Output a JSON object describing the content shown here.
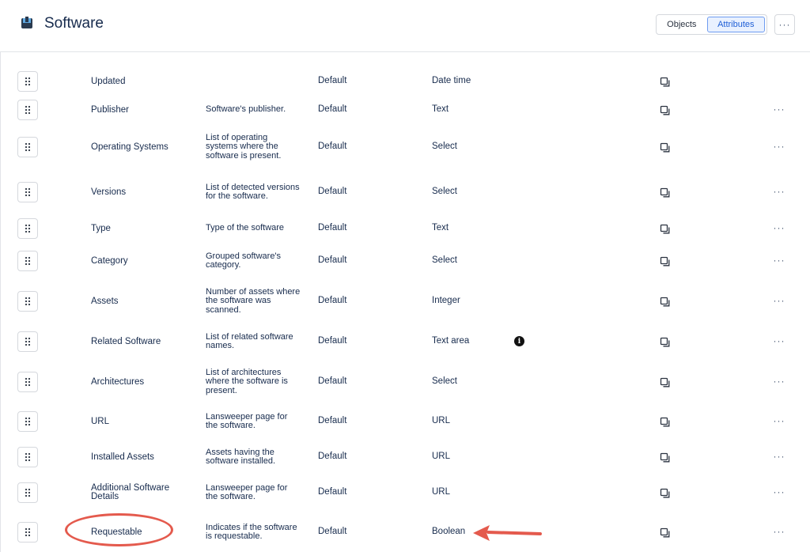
{
  "header": {
    "title": "Software",
    "toggle": {
      "objects_label": "Objects",
      "attributes_label": "Attributes",
      "selected": "Attributes"
    },
    "more_label": "···",
    "icon": "software-box-icon"
  },
  "colors": {
    "accent": "#1f5fd6",
    "accent_bg": "#e9f1ff",
    "annotation": "#e45a4d"
  },
  "rows": [
    {
      "name": "Updated",
      "description": "",
      "scope": "Default",
      "type": "Date time",
      "has_more": false
    },
    {
      "name": "Publisher",
      "description": "Software's publisher.",
      "scope": "Default",
      "type": "Text",
      "has_more": true
    },
    {
      "name": "Operating Systems",
      "description": "List of operating systems where the software is present.",
      "scope": "Default",
      "type": "Select",
      "has_more": true
    },
    {
      "name": "Versions",
      "description": "List of detected versions for the software.",
      "scope": "Default",
      "type": "Select",
      "has_more": true
    },
    {
      "name": "Type",
      "description": "Type of the software",
      "scope": "Default",
      "type": "Text",
      "has_more": true
    },
    {
      "name": "Category",
      "description": "Grouped software's category.",
      "scope": "Default",
      "type": "Select",
      "has_more": true
    },
    {
      "name": "Assets",
      "description": "Number of assets where the software was scanned.",
      "scope": "Default",
      "type": "Integer",
      "has_more": true
    },
    {
      "name": "Related Software",
      "description": "List of related software names.",
      "scope": "Default",
      "type": "Text area",
      "has_more": true,
      "info_icon": "i"
    },
    {
      "name": "Architectures",
      "description": "List of architectures where the software is present.",
      "scope": "Default",
      "type": "Select",
      "has_more": true
    },
    {
      "name": "URL",
      "description": "Lansweeper page for the software.",
      "scope": "Default",
      "type": "URL",
      "has_more": true
    },
    {
      "name": "Installed Assets",
      "description": "Assets having the software installed.",
      "scope": "Default",
      "type": "URL",
      "has_more": true
    },
    {
      "name": "Additional Software Details",
      "description": "Lansweeper page for the software.",
      "scope": "Default",
      "type": "URL",
      "has_more": true
    },
    {
      "name": "Requestable",
      "description": "Indicates if the software is requestable.",
      "scope": "Default",
      "type": "Boolean",
      "has_more": true
    }
  ],
  "more_glyph": "···",
  "icons": {
    "drag": "drag-handle-icon",
    "copy": "copy-icon",
    "info": "info-icon",
    "more": "more-icon"
  }
}
